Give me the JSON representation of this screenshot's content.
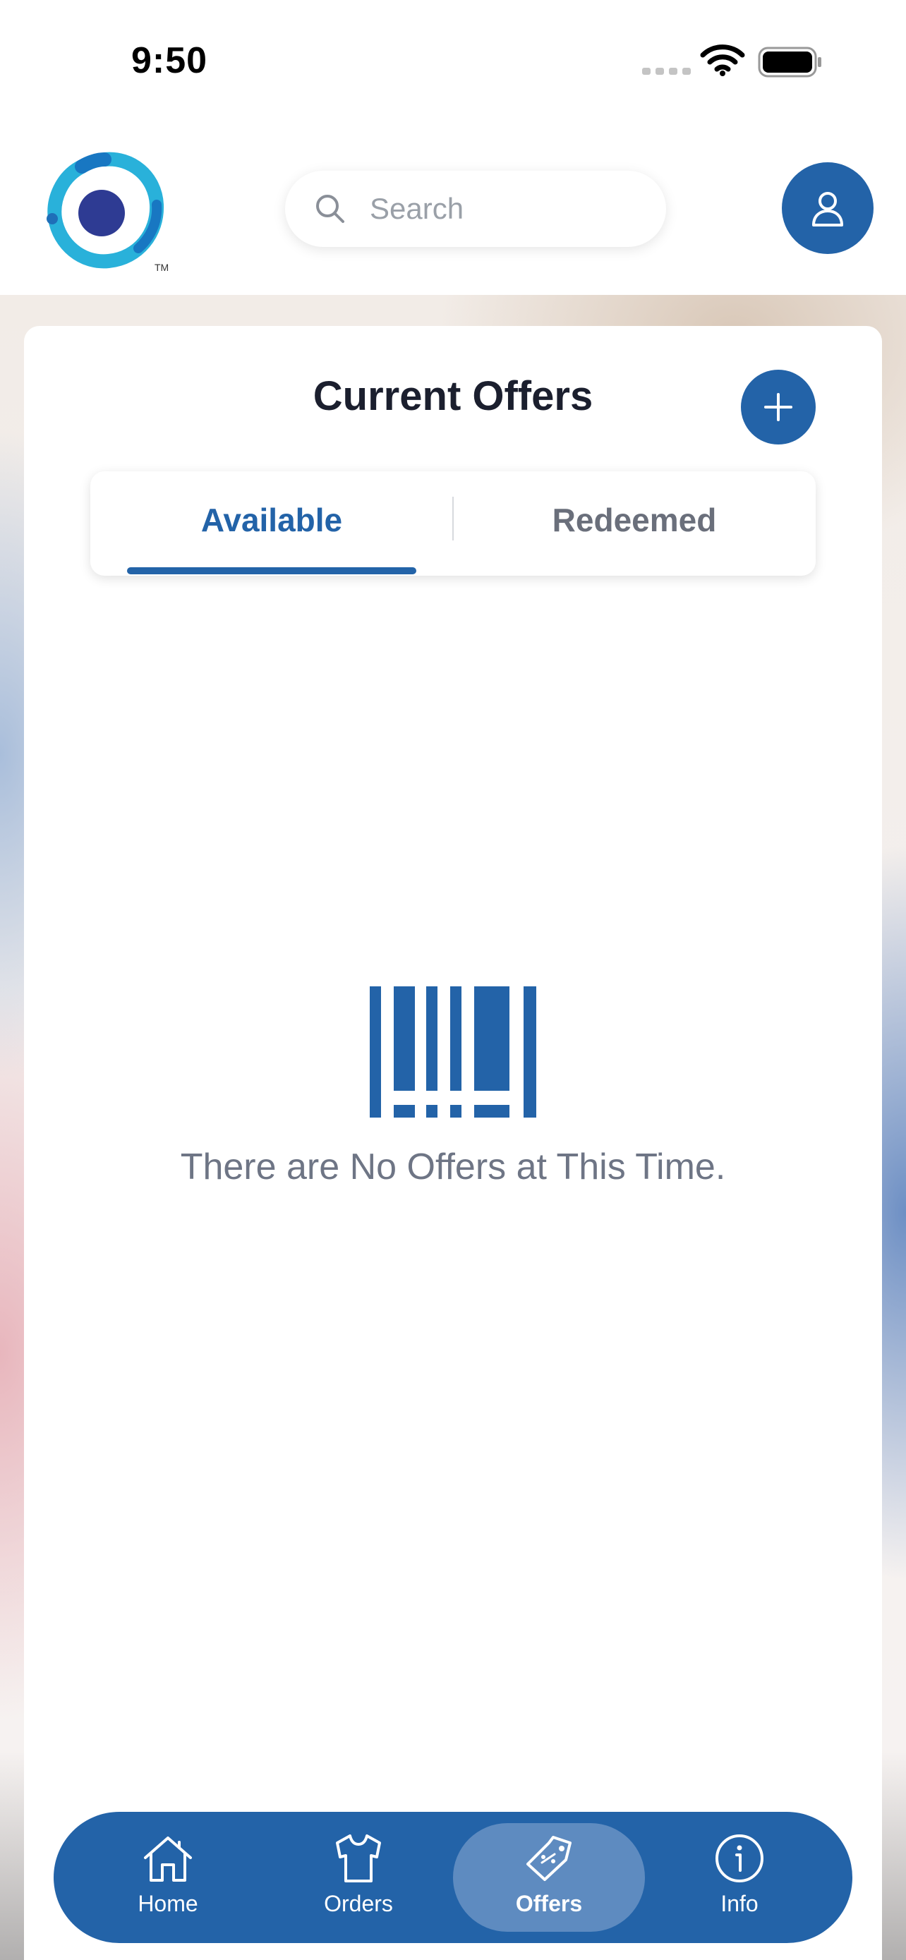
{
  "status_bar": {
    "time": "9:50"
  },
  "header": {
    "logo_trademark": "TM",
    "search": {
      "placeholder": "Search",
      "value": ""
    }
  },
  "offers": {
    "title": "Current Offers",
    "tabs": [
      {
        "label": "Available",
        "selected": true
      },
      {
        "label": "Redeemed",
        "selected": false
      }
    ],
    "empty_message": "There are No Offers at This Time."
  },
  "bottom_nav": {
    "items": [
      {
        "label": "Home",
        "icon": "home-icon",
        "active": false
      },
      {
        "label": "Orders",
        "icon": "shirt-icon",
        "active": false
      },
      {
        "label": "Offers",
        "icon": "tag-icon",
        "active": true
      },
      {
        "label": "Info",
        "icon": "info-icon",
        "active": false
      }
    ]
  },
  "colors": {
    "brand_blue": "#2363a8",
    "active_nav_pill": "#5e8bc0",
    "muted_text": "#6e7585"
  }
}
